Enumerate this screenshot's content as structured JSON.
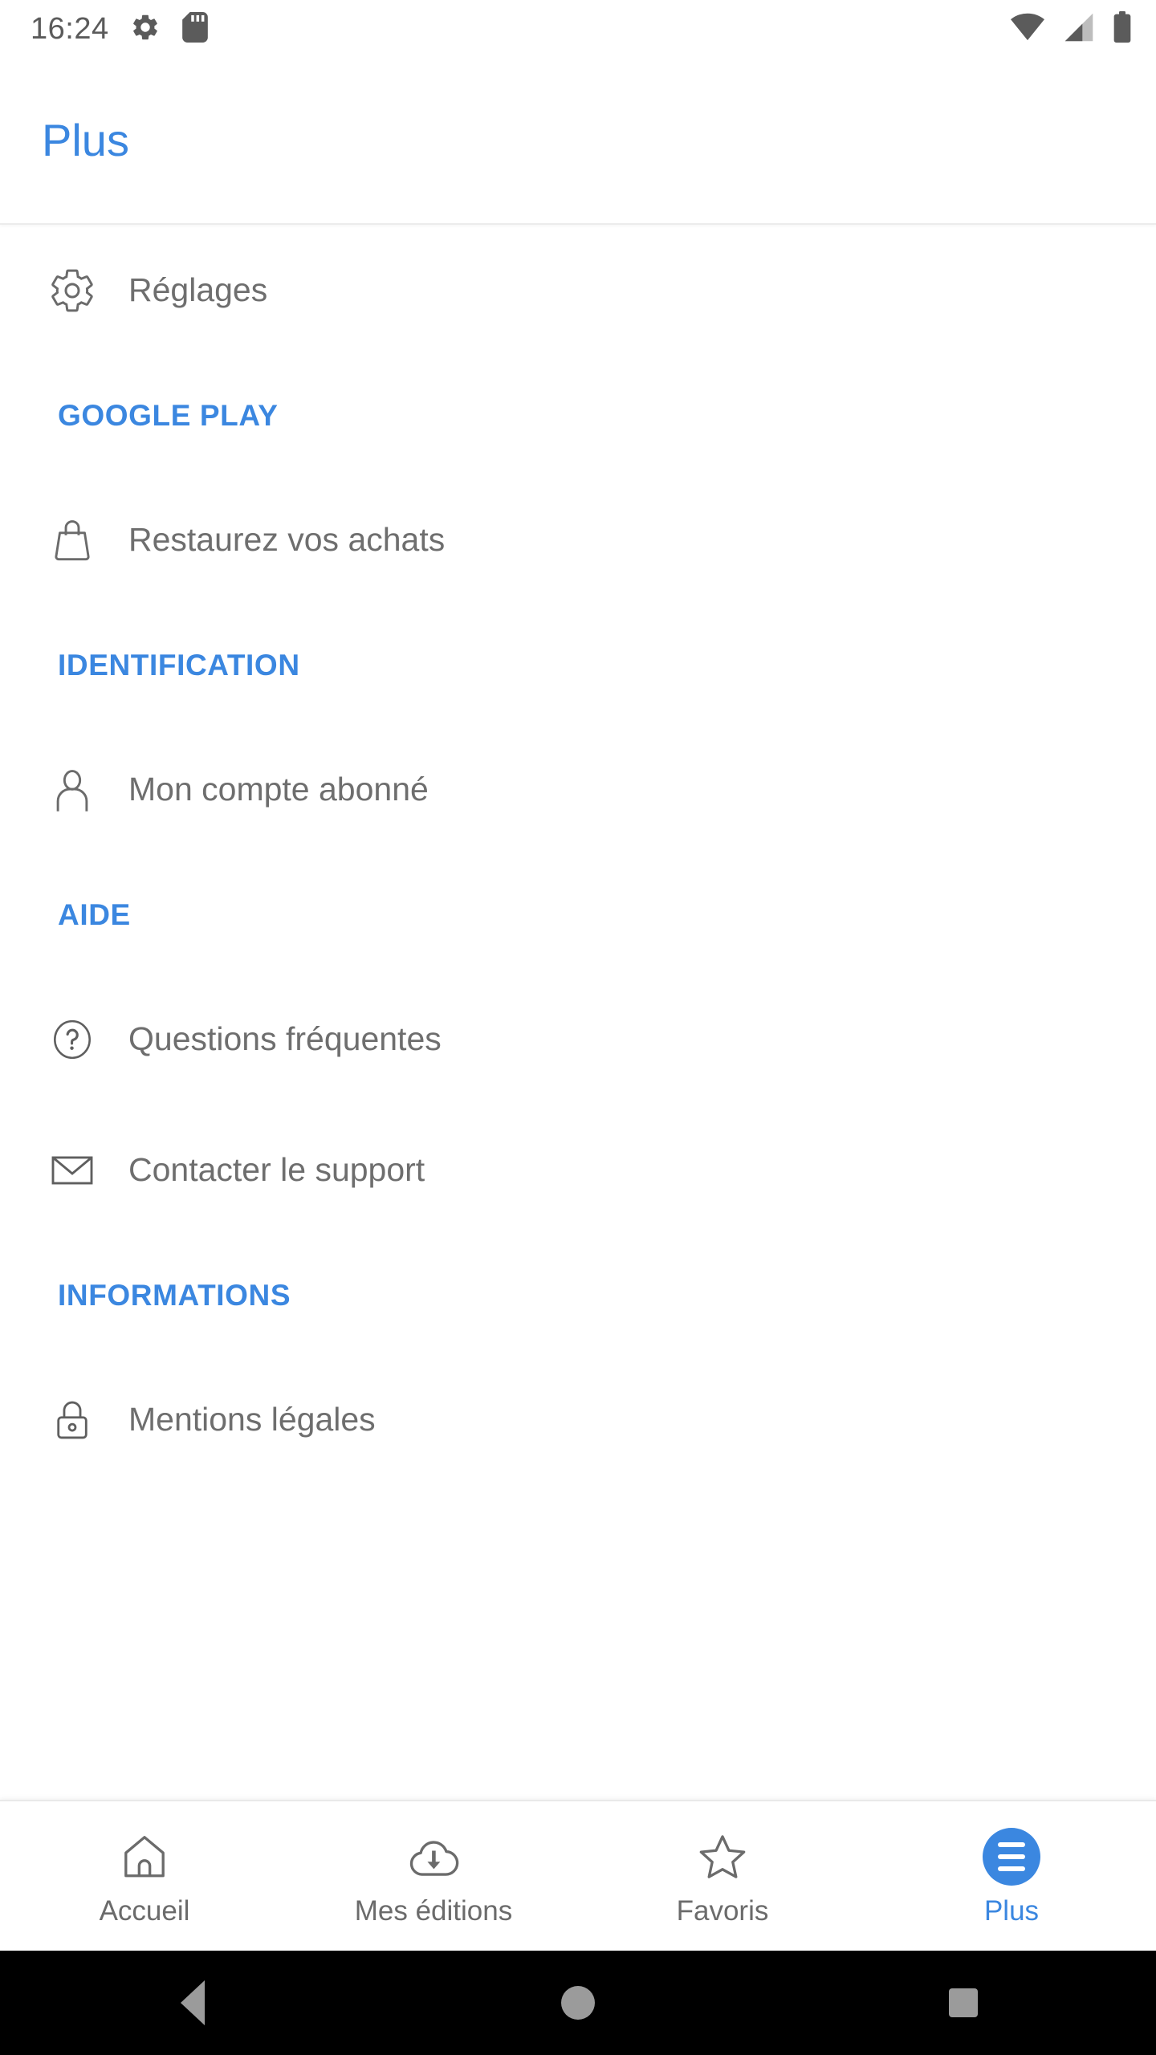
{
  "theme": {
    "accent_blue": "#3b87e0",
    "label_gray": "#6e6e6e",
    "icon_gray": "#6b6b6b",
    "background": "#ffffff"
  },
  "status_bar": {
    "clock": "16:24",
    "left_icons": [
      "gear-icon",
      "sd-card-icon"
    ],
    "right_icons": [
      "wifi-icon",
      "cellular-signal-icon",
      "battery-icon"
    ]
  },
  "header": {
    "title": "Plus"
  },
  "list": [
    {
      "type": "item",
      "label": "Réglages",
      "icon": "gear-icon"
    },
    {
      "type": "section",
      "label": "GOOGLE PLAY"
    },
    {
      "type": "item",
      "label": "Restaurez vos achats",
      "icon": "shopping-bag-icon"
    },
    {
      "type": "section",
      "label": "IDENTIFICATION"
    },
    {
      "type": "item",
      "label": "Mon compte abonné",
      "icon": "person-icon"
    },
    {
      "type": "section",
      "label": "AIDE"
    },
    {
      "type": "item",
      "label": "Questions fréquentes",
      "icon": "help-circle-icon"
    },
    {
      "type": "item",
      "label": "Contacter le support",
      "icon": "envelope-icon"
    },
    {
      "type": "section",
      "label": "INFORMATIONS"
    },
    {
      "type": "item",
      "label": "Mentions légales",
      "icon": "lock-icon"
    }
  ],
  "bottom_nav": {
    "items": [
      {
        "label": "Accueil",
        "icon": "home-icon",
        "active": false
      },
      {
        "label": "Mes éditions",
        "icon": "cloud-download-icon",
        "active": false
      },
      {
        "label": "Favoris",
        "icon": "star-icon",
        "active": false
      },
      {
        "label": "Plus",
        "icon": "hamburger-menu-icon",
        "active": true
      }
    ]
  },
  "system_nav": {
    "buttons": [
      "back-button",
      "home-button",
      "recents-button"
    ]
  }
}
